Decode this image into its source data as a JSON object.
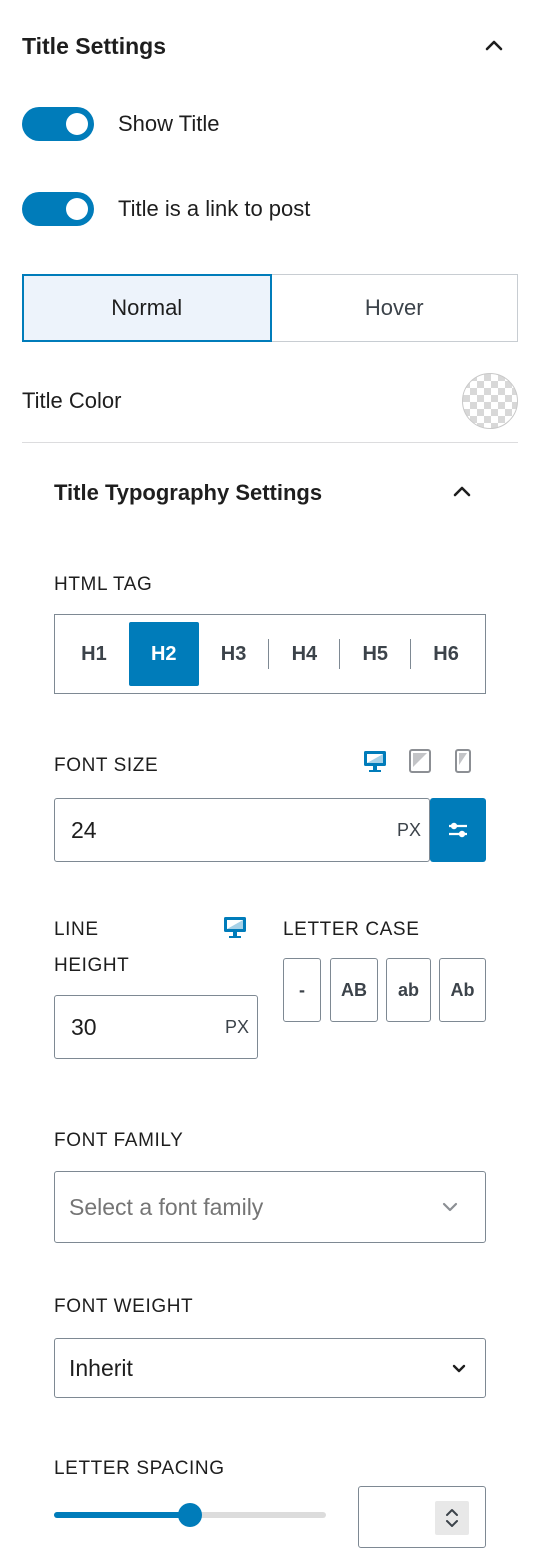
{
  "title_settings": {
    "heading": "Title Settings",
    "toggles": [
      {
        "label": "Show Title",
        "on": true
      },
      {
        "label": "Title is a link to post",
        "on": true
      }
    ],
    "state_tabs": {
      "items": [
        "Normal",
        "Hover"
      ],
      "selected": "Normal"
    },
    "title_color_label": "Title Color"
  },
  "typography": {
    "heading": "Title Typography Settings",
    "html_tag": {
      "label": "HTML TAG",
      "options": [
        "H1",
        "H2",
        "H3",
        "H4",
        "H5",
        "H6"
      ],
      "selected": "H2"
    },
    "font_size": {
      "label": "FONT SIZE",
      "value": "24",
      "unit": "PX",
      "devices": [
        "desktop-icon",
        "tablet-icon",
        "mobile-icon"
      ],
      "active_device": "desktop"
    },
    "line_height": {
      "label_line1": "LINE",
      "label_line2": "HEIGHT",
      "value": "30",
      "unit": "PX"
    },
    "letter_case": {
      "label": "LETTER CASE",
      "options": [
        "-",
        "AB",
        "ab",
        "Ab"
      ]
    },
    "font_family": {
      "label": "FONT FAMILY",
      "placeholder": "Select a font family"
    },
    "font_weight": {
      "label": "FONT WEIGHT",
      "value": "Inherit"
    },
    "letter_spacing": {
      "label": "LETTER SPACING",
      "slider_level": 0.5,
      "value": ""
    }
  },
  "colors": {
    "accent": "#007cba",
    "border": "#7e8993",
    "selected_tab_bg": "#edf3fb"
  }
}
